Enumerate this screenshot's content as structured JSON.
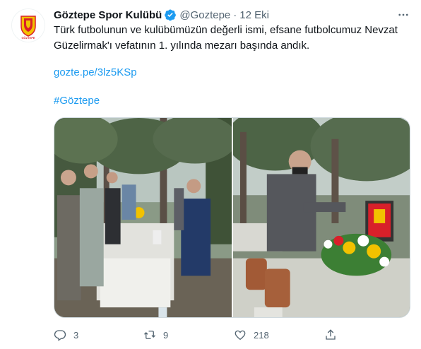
{
  "tweet": {
    "author_name": "Göztepe Spor Kulübü",
    "handle": "@Goztepe",
    "separator": "·",
    "time": "12 Eki",
    "text": "Türk futbolunun ve kulübümüzün değerli ismi, efsane futbolcumuz Nevzat Güzelirmak'ı vefatının 1. yılında mezarı başında andık.",
    "link": "gozte.pe/3lz5KSp",
    "hashtag": "#Göztepe"
  },
  "avatar": {
    "logo_text": "GÖZTEPE",
    "logo_subtext": "SPOR KULÜBÜ"
  },
  "actions": {
    "reply_count": "3",
    "retweet_count": "9",
    "like_count": "218"
  },
  "colors": {
    "accent": "#1d9bf0",
    "text_primary": "#0f1419",
    "text_secondary": "#536471",
    "brand_yellow": "#f2c200",
    "brand_red": "#d8202a"
  }
}
